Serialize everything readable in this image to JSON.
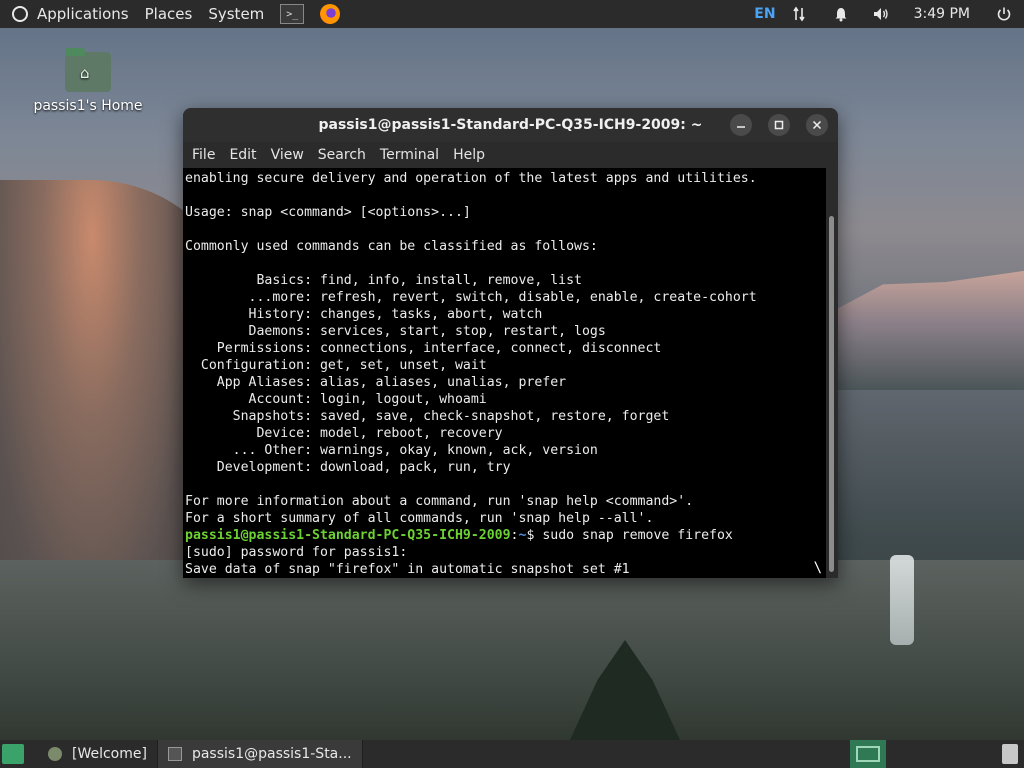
{
  "top_panel": {
    "applications": "Applications",
    "places": "Places",
    "system": "System",
    "terminal_launcher_glyph": ">_",
    "language": "EN",
    "clock": "3:49 PM"
  },
  "desktop": {
    "home_icon_label": "passis1's Home"
  },
  "terminal": {
    "title": "passis1@passis1-Standard-PC-Q35-ICH9-2009: ~",
    "menu": [
      "File",
      "Edit",
      "View",
      "Search",
      "Terminal",
      "Help"
    ],
    "lines_before_prompt": [
      "enabling secure delivery and operation of the latest apps and utilities.",
      "",
      "Usage: snap <command> [<options>...]",
      "",
      "Commonly used commands can be classified as follows:",
      "",
      "         Basics: find, info, install, remove, list",
      "        ...more: refresh, revert, switch, disable, enable, create-cohort",
      "        History: changes, tasks, abort, watch",
      "        Daemons: services, start, stop, restart, logs",
      "    Permissions: connections, interface, connect, disconnect",
      "  Configuration: get, set, unset, wait",
      "    App Aliases: alias, aliases, unalias, prefer",
      "        Account: login, logout, whoami",
      "      Snapshots: saved, save, check-snapshot, restore, forget",
      "         Device: model, reboot, recovery",
      "      ... Other: warnings, okay, known, ack, version",
      "    Development: download, pack, run, try",
      "",
      "For more information about a command, run 'snap help <command>'.",
      "For a short summary of all commands, run 'snap help --all'."
    ],
    "prompt_user": "passis1@passis1-Standard-PC-Q35-ICH9-2009",
    "prompt_sep": ":",
    "prompt_path": "~",
    "prompt_command": "$ sudo snap remove firefox",
    "lines_after_prompt": [
      "[sudo] password for passis1:",
      "Save data of snap \"firefox\" in automatic snapshot set #1"
    ],
    "spinner": "\\"
  },
  "taskbar": {
    "tasks": [
      {
        "label": "[Welcome]",
        "icon": "gear-icon"
      },
      {
        "label": "passis1@passis1-Sta...",
        "icon": "terminal-icon"
      }
    ]
  },
  "colors": {
    "panel": "#2b2b2b",
    "prompt_user": "#6cd133",
    "prompt_path": "#4b8fe0",
    "language": "#4aa3f5"
  }
}
